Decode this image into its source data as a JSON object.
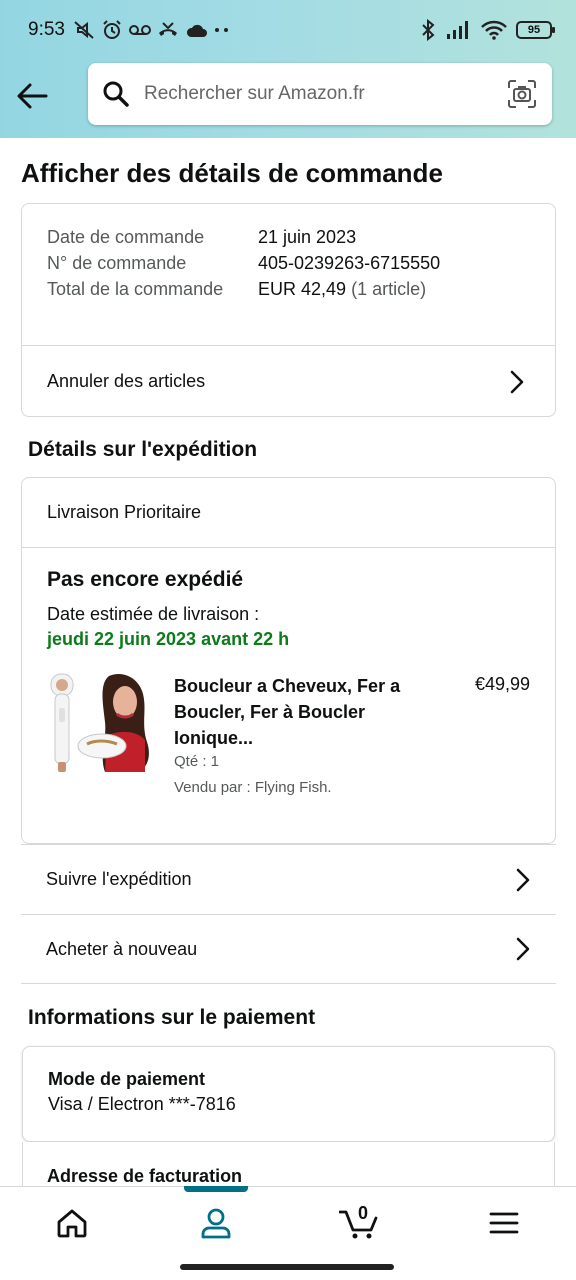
{
  "status_bar": {
    "time": "9:53",
    "battery": "95"
  },
  "search": {
    "placeholder": "Rechercher sur Amazon.fr"
  },
  "page_title": "Afficher des détails de commande",
  "order": {
    "date_label": "Date de commande",
    "date_value": "21 juin 2023",
    "number_label": "N° de commande",
    "number_value": "405-0239263-6715550",
    "total_label": "Total de la commande",
    "total_value": "EUR 42,49",
    "total_count": "(1 article)",
    "cancel_label": "Annuler des articles"
  },
  "shipping": {
    "section_title": "Détails sur l'expédition",
    "method": "Livraison Prioritaire",
    "status": "Pas encore expédié",
    "eta_label": "Date estimée de livraison :",
    "eta_date": "jeudi 22 juin 2023 avant 22 h",
    "product": {
      "title": "Boucleur a Cheveux, Fer a Boucler, Fer à Boucler Ionique...",
      "price": "€49,99",
      "qty": "Qté : 1",
      "seller": "Vendu par : Flying Fish."
    }
  },
  "links": {
    "track": "Suivre l'expédition",
    "buy_again": "Acheter à nouveau"
  },
  "payment": {
    "section_title": "Informations sur le paiement",
    "method_label": "Mode de paiement",
    "method_value": "Visa / Electron  ***-7816",
    "billing_label": "Adresse de facturation"
  },
  "bottom_nav": {
    "cart_count": "0",
    "active": "account"
  },
  "colors": {
    "header_gradient": "#a4dce4",
    "delivery_green": "#0b7c19",
    "active_nav": "#007185"
  }
}
